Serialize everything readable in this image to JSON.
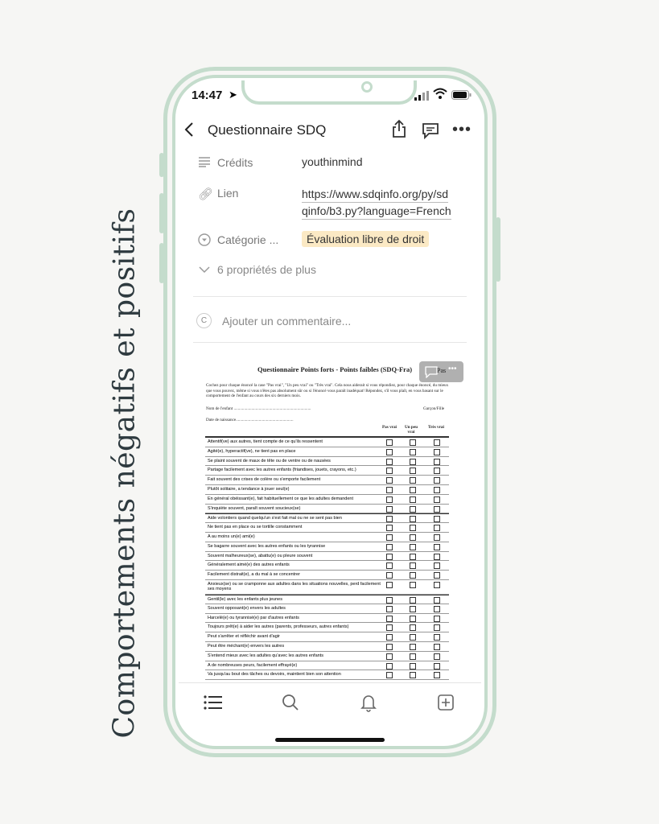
{
  "side_title": "Comportements négatifs et positifs",
  "status": {
    "time": "14:47"
  },
  "nav": {
    "title": "Questionnaire SDQ"
  },
  "properties": [
    {
      "label": "Crédits",
      "value": "youthinmind",
      "icon": "lines-icon"
    },
    {
      "label": "Lien",
      "value": "https://www.sdqinfo.org/py/sdqinfo/b3.py?language=French",
      "value_line1": "https://www.sdqinfo.org/py/sd",
      "value_line2": "qinfo/b3.py?language=French",
      "icon": "link-icon"
    },
    {
      "label": "Catégorie ...",
      "value": "Évaluation libre de droit",
      "icon": "select-icon"
    }
  ],
  "more_props": "6 propriétés de plus",
  "comment": {
    "avatar": "C",
    "placeholder": "Ajouter un commentaire..."
  },
  "document": {
    "title": "Questionnaire Points forts - Points faibles (SDQ-Fra)",
    "overlay_text": "Pas",
    "instructions": "Cochez pour chaque énoncé la case \"Pas vrai\", \"Un peu vrai\" ou \"Très vrai\". Cela nous aiderait si vous répondiez, pour chaque énoncé, du mieux que vous pouvez, même si vous n'êtes pas absolument sûr ou si l'énoncé vous paraît inadéquat! Répondez, s'il vous plaît, en vous basant sur le comportement de l'enfant au cours des six derniers mois.",
    "child_name": "Nom de l'enfant ..........................................................................",
    "gender": "Garçon/Fille",
    "birthdate": "Date de naissance.......................................................",
    "columns": [
      "Pas vrai",
      "Un peu vrai",
      "Très vrai"
    ],
    "items": [
      "Attentif(ve) aux autres, tient compte de ce qu'ils ressentent",
      "Agité(e), hyperactif(ve), ne tient pas en place",
      "Se plaint souvent de maux de tête ou de ventre ou de nausées",
      "Partage facilement avec les autres enfants (friandises, jouets, crayons, etc.)",
      "Fait souvent des crises de colère ou s'emporte facilement",
      "Plutôt solitaire, a tendance à jouer seul(e)",
      "En général obéissant(e), fait habituellement ce que les adultes demandent",
      "S'inquiète souvent, paraît souvent soucieux(se)",
      "Aide volontiers quand quelqu'un s'est fait mal ou ne se sent pas bien",
      "Ne tient pas en place ou se tortille constamment",
      "A au moins un(e) ami(e)",
      "Se bagarre souvent avec les autres enfants ou les tyrannise",
      "Souvent malheureux(se), abattu(e) ou pleure souvent",
      "Généralement aimé(e) des autres enfants",
      "Facilement distrait(e), a du mal à se concentrer",
      "Anxieux(se) ou se cramponne aux adultes dans les situations nouvelles, perd facilement ses moyens",
      "Gentil(le) avec les enfants plus jeunes",
      "Souvent opposant(e) envers les adultes",
      "Harcelé(e) ou tyrannisé(e) par d'autres enfants",
      "Toujours prêt(e) à aider les autres (parents, professeurs, autres enfants)",
      "Peut s'arrêter et réfléchir avant d'agir",
      "Peut être méchant(e) envers les autres",
      "S'entend mieux avec les adultes qu'avec les autres enfants",
      "A de nombreuses peurs, facilement effrayé(e)",
      "Va jusqu'au bout des tâches ou devoirs, maintient bien son attention"
    ]
  },
  "colors": {
    "frame": "#c4dccc",
    "tag_bg": "#fbe9c4",
    "background": "#f6f6f4"
  }
}
